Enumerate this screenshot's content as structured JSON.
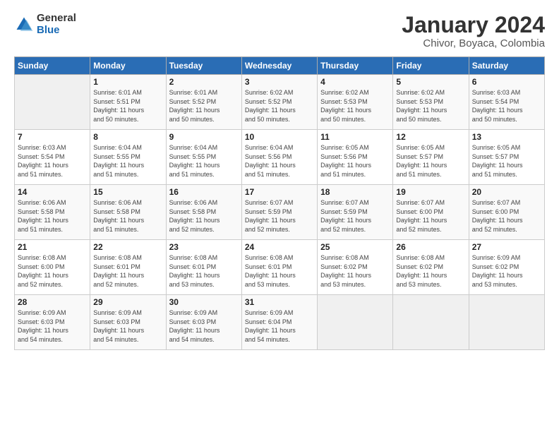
{
  "logo": {
    "general": "General",
    "blue": "Blue"
  },
  "title": "January 2024",
  "subtitle": "Chivor, Boyaca, Colombia",
  "days_header": [
    "Sunday",
    "Monday",
    "Tuesday",
    "Wednesday",
    "Thursday",
    "Friday",
    "Saturday"
  ],
  "weeks": [
    [
      {
        "num": "",
        "detail": ""
      },
      {
        "num": "1",
        "detail": "Sunrise: 6:01 AM\nSunset: 5:51 PM\nDaylight: 11 hours\nand 50 minutes."
      },
      {
        "num": "2",
        "detail": "Sunrise: 6:01 AM\nSunset: 5:52 PM\nDaylight: 11 hours\nand 50 minutes."
      },
      {
        "num": "3",
        "detail": "Sunrise: 6:02 AM\nSunset: 5:52 PM\nDaylight: 11 hours\nand 50 minutes."
      },
      {
        "num": "4",
        "detail": "Sunrise: 6:02 AM\nSunset: 5:53 PM\nDaylight: 11 hours\nand 50 minutes."
      },
      {
        "num": "5",
        "detail": "Sunrise: 6:02 AM\nSunset: 5:53 PM\nDaylight: 11 hours\nand 50 minutes."
      },
      {
        "num": "6",
        "detail": "Sunrise: 6:03 AM\nSunset: 5:54 PM\nDaylight: 11 hours\nand 50 minutes."
      }
    ],
    [
      {
        "num": "7",
        "detail": "Sunrise: 6:03 AM\nSunset: 5:54 PM\nDaylight: 11 hours\nand 51 minutes."
      },
      {
        "num": "8",
        "detail": "Sunrise: 6:04 AM\nSunset: 5:55 PM\nDaylight: 11 hours\nand 51 minutes."
      },
      {
        "num": "9",
        "detail": "Sunrise: 6:04 AM\nSunset: 5:55 PM\nDaylight: 11 hours\nand 51 minutes."
      },
      {
        "num": "10",
        "detail": "Sunrise: 6:04 AM\nSunset: 5:56 PM\nDaylight: 11 hours\nand 51 minutes."
      },
      {
        "num": "11",
        "detail": "Sunrise: 6:05 AM\nSunset: 5:56 PM\nDaylight: 11 hours\nand 51 minutes."
      },
      {
        "num": "12",
        "detail": "Sunrise: 6:05 AM\nSunset: 5:57 PM\nDaylight: 11 hours\nand 51 minutes."
      },
      {
        "num": "13",
        "detail": "Sunrise: 6:05 AM\nSunset: 5:57 PM\nDaylight: 11 hours\nand 51 minutes."
      }
    ],
    [
      {
        "num": "14",
        "detail": "Sunrise: 6:06 AM\nSunset: 5:58 PM\nDaylight: 11 hours\nand 51 minutes."
      },
      {
        "num": "15",
        "detail": "Sunrise: 6:06 AM\nSunset: 5:58 PM\nDaylight: 11 hours\nand 51 minutes."
      },
      {
        "num": "16",
        "detail": "Sunrise: 6:06 AM\nSunset: 5:58 PM\nDaylight: 11 hours\nand 52 minutes."
      },
      {
        "num": "17",
        "detail": "Sunrise: 6:07 AM\nSunset: 5:59 PM\nDaylight: 11 hours\nand 52 minutes."
      },
      {
        "num": "18",
        "detail": "Sunrise: 6:07 AM\nSunset: 5:59 PM\nDaylight: 11 hours\nand 52 minutes."
      },
      {
        "num": "19",
        "detail": "Sunrise: 6:07 AM\nSunset: 6:00 PM\nDaylight: 11 hours\nand 52 minutes."
      },
      {
        "num": "20",
        "detail": "Sunrise: 6:07 AM\nSunset: 6:00 PM\nDaylight: 11 hours\nand 52 minutes."
      }
    ],
    [
      {
        "num": "21",
        "detail": "Sunrise: 6:08 AM\nSunset: 6:00 PM\nDaylight: 11 hours\nand 52 minutes."
      },
      {
        "num": "22",
        "detail": "Sunrise: 6:08 AM\nSunset: 6:01 PM\nDaylight: 11 hours\nand 52 minutes."
      },
      {
        "num": "23",
        "detail": "Sunrise: 6:08 AM\nSunset: 6:01 PM\nDaylight: 11 hours\nand 53 minutes."
      },
      {
        "num": "24",
        "detail": "Sunrise: 6:08 AM\nSunset: 6:01 PM\nDaylight: 11 hours\nand 53 minutes."
      },
      {
        "num": "25",
        "detail": "Sunrise: 6:08 AM\nSunset: 6:02 PM\nDaylight: 11 hours\nand 53 minutes."
      },
      {
        "num": "26",
        "detail": "Sunrise: 6:08 AM\nSunset: 6:02 PM\nDaylight: 11 hours\nand 53 minutes."
      },
      {
        "num": "27",
        "detail": "Sunrise: 6:09 AM\nSunset: 6:02 PM\nDaylight: 11 hours\nand 53 minutes."
      }
    ],
    [
      {
        "num": "28",
        "detail": "Sunrise: 6:09 AM\nSunset: 6:03 PM\nDaylight: 11 hours\nand 54 minutes."
      },
      {
        "num": "29",
        "detail": "Sunrise: 6:09 AM\nSunset: 6:03 PM\nDaylight: 11 hours\nand 54 minutes."
      },
      {
        "num": "30",
        "detail": "Sunrise: 6:09 AM\nSunset: 6:03 PM\nDaylight: 11 hours\nand 54 minutes."
      },
      {
        "num": "31",
        "detail": "Sunrise: 6:09 AM\nSunset: 6:04 PM\nDaylight: 11 hours\nand 54 minutes."
      },
      {
        "num": "",
        "detail": ""
      },
      {
        "num": "",
        "detail": ""
      },
      {
        "num": "",
        "detail": ""
      }
    ]
  ]
}
